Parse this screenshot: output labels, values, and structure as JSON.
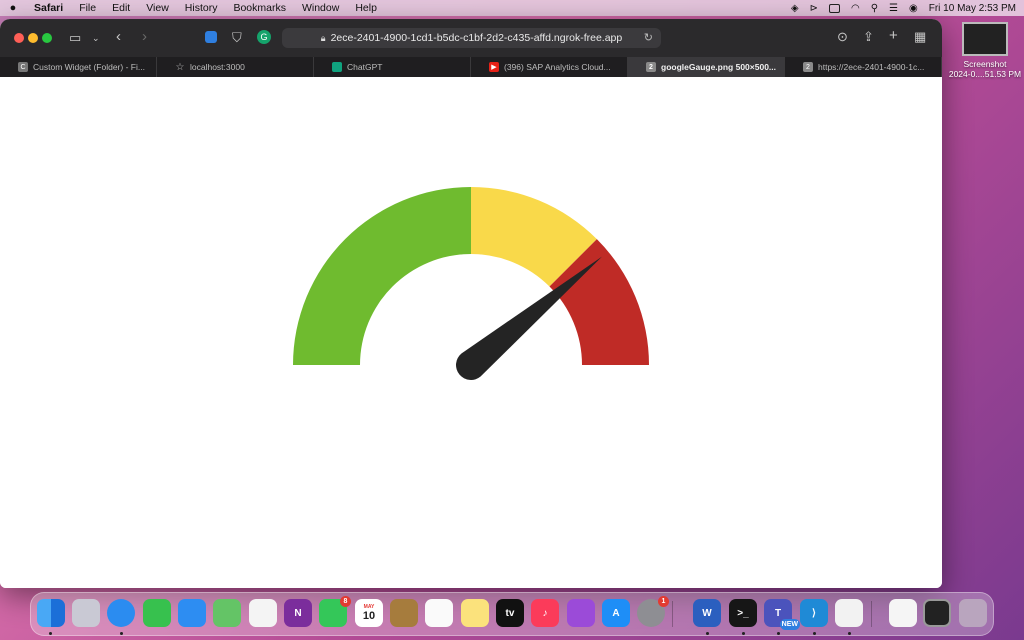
{
  "menubar": {
    "app": "Safari",
    "items": [
      "File",
      "Edit",
      "View",
      "History",
      "Bookmarks",
      "Window",
      "Help"
    ],
    "datetime": "Fri 10 May  2:53 PM"
  },
  "browser": {
    "url": "2ece-2401-4900-1cd1-b5dc-c1bf-2d2-c435-affd.ngrok-free.app",
    "tabs": [
      {
        "label": "Custom Widget (Folder) - Fi...",
        "icon": "C",
        "active": false
      },
      {
        "label": "localhost:3000",
        "icon": "☆",
        "active": false
      },
      {
        "label": "ChatGPT",
        "icon": "",
        "active": false
      },
      {
        "label": "(396) SAP Analytics Cloud...",
        "icon": "▶",
        "active": false
      },
      {
        "label": "googleGauge.png 500×500...",
        "icon": "2",
        "active": true
      },
      {
        "label": "https://2ece-2401-4900-1c...",
        "icon": "2",
        "active": false
      }
    ]
  },
  "gauge": {
    "needle_value": 0.78,
    "segments": [
      {
        "name": "green",
        "from": 0,
        "to": 0.5,
        "color": "#6fbb2f"
      },
      {
        "name": "yellow",
        "from": 0.5,
        "to": 0.75,
        "color": "#f9d94a"
      },
      {
        "name": "red",
        "from": 0.75,
        "to": 1.0,
        "color": "#bf2b26"
      }
    ],
    "needle_color": "#242424"
  },
  "desktop": {
    "file_label_1": "Screenshot",
    "file_label_2": "2024-0....51.53 PM"
  },
  "dock": {
    "facetime_badge": "8",
    "calendar_month": "MAY",
    "calendar_day": "10",
    "settings_badge": "1",
    "teams_badge": "NEW"
  }
}
